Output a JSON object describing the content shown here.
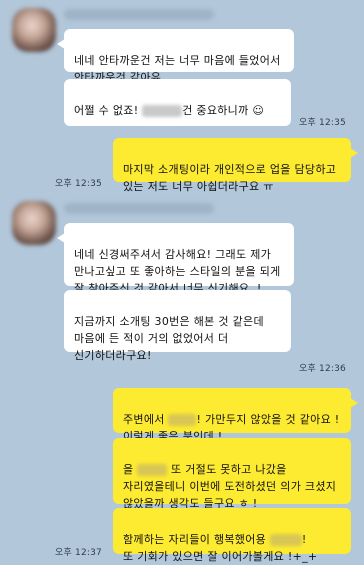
{
  "messages": [
    {
      "id": "m1",
      "direction": "in",
      "text": "네네 안타까운건 저는 너무 마음에 들었어서 안타까운것 같아유"
    },
    {
      "id": "m2",
      "direction": "in",
      "text_before": "어쩔 수 없죠! ",
      "text_after": "건 중요하니까 ☺",
      "time": "오후 12:35"
    },
    {
      "id": "m3",
      "direction": "out",
      "text": "마지막 소개팅이라 개인적으로 업을 담당하고 있는 저도 너무 아쉽더라구요 ㅠ",
      "time": "오후 12:35"
    },
    {
      "id": "m4",
      "direction": "in",
      "text": "네네 신경써주셔서 감사해요! 그래도 제가 만나고싶고 또 좋아하는 스타일의 분을 되게 잘 찾아주신 것 같아서 너무 신기해요..!"
    },
    {
      "id": "m5",
      "direction": "in",
      "text": "지금까지 소개팅 30번은 해본 것 같은데 마음에 든 적이 거의 없었어서 더 신기하더라구요!",
      "time": "오후 12:36"
    },
    {
      "id": "m6",
      "direction": "out",
      "text_before": "주변에서 ",
      "text_after": "! 가만두지 않았을 것 같아요 ! 이렇게 좋은 분인데 !"
    },
    {
      "id": "m7",
      "direction": "out",
      "text_before": "을 ",
      "text_after": " 또 거절도 못하고 나갔을 자리였을테니 이번에 도전하셨던 의가 크셨지 않았을까 생각도 들구요 ㅎ !"
    },
    {
      "id": "m8",
      "direction": "out",
      "text_before": "함께하는 자리들이 행복했어용 ",
      "text_after": "!\n또 기회가 있으면 잘 이어가볼게요 !+_+",
      "time": "오후 12:37"
    }
  ]
}
